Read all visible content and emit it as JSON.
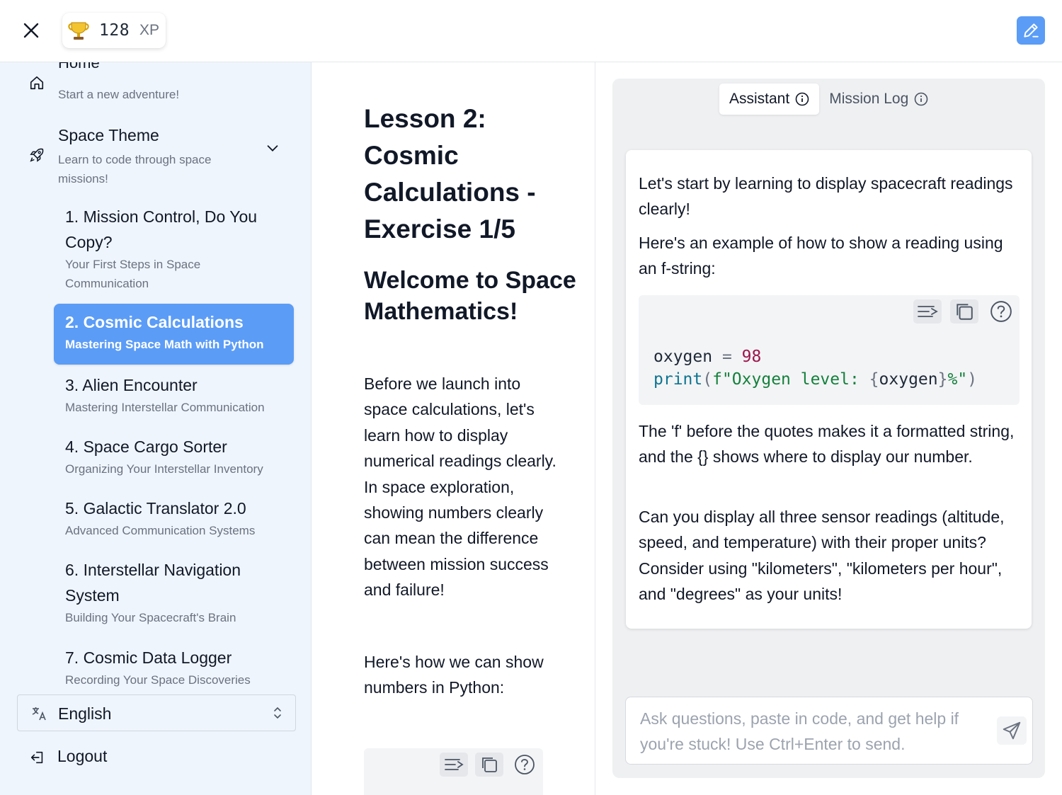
{
  "topbar": {
    "xp_value": "128",
    "xp_unit": "XP"
  },
  "sidebar": {
    "home": {
      "title": "Home",
      "subtitle": "Start a new adventure!"
    },
    "theme": {
      "title": "Space Theme",
      "subtitle": "Learn to code through space missions!"
    },
    "lessons": [
      {
        "title": "1. Mission Control, Do You Copy?",
        "subtitle": "Your First Steps in Space Communication",
        "active": false
      },
      {
        "title": "2. Cosmic Calculations",
        "subtitle": "Mastering Space Math with Python",
        "active": true
      },
      {
        "title": "3. Alien Encounter",
        "subtitle": "Mastering Interstellar Communication",
        "active": false
      },
      {
        "title": "4. Space Cargo Sorter",
        "subtitle": "Organizing Your Interstellar Inventory",
        "active": false
      },
      {
        "title": "5. Galactic Translator 2.0",
        "subtitle": "Advanced Communication Systems",
        "active": false
      },
      {
        "title": "6. Interstellar Navigation System",
        "subtitle": "Building Your Spacecraft's Brain",
        "active": false
      },
      {
        "title": "7. Cosmic Data Logger",
        "subtitle": "Recording Your Space Discoveries",
        "active": false
      }
    ],
    "language": "English",
    "logout": "Logout"
  },
  "content": {
    "title": "Lesson 2: Cosmic Calculations - Exercise 1/5",
    "heading": "Welcome to Space Mathematics!",
    "para1": "Before we launch into space calculations, let's learn how to display numerical readings clearly. In space exploration, showing numbers clearly can mean the difference between mission success and failure!",
    "para2": "Here's how we can show numbers in Python:"
  },
  "assistant": {
    "tabs": [
      {
        "label": "Assistant",
        "active": true
      },
      {
        "label": "Mission Log",
        "active": false
      }
    ],
    "message": {
      "p1": "Let's start by learning to display spacecraft readings clearly!",
      "p2": "Here's an example of how to show a reading using an f-string:",
      "code": {
        "line1_var": "oxygen",
        "line1_op": "=",
        "line1_num": "98",
        "line2_fn": "print",
        "line2_open": "(",
        "line2_str_start": "f\"Oxygen level: ",
        "line2_brace_open": "{",
        "line2_var": "oxygen",
        "line2_brace_close": "}",
        "line2_str_end": "%\"",
        "line2_close": ")"
      },
      "p3": "The 'f' before the quotes makes it a formatted string, and the {} shows where to display our number.",
      "p4": "Can you display all three sensor readings (altitude, speed, and temperature) with their proper units? Consider using \"kilometers\", \"kilometers per hour\", and \"degrees\" as your units!"
    },
    "input_placeholder": "Ask questions, paste in code, and get help if you're stuck! Use Ctrl+Enter to send."
  },
  "colors": {
    "accent": "#5b9cf6",
    "sidebar_bg": "#eff5fc",
    "panel_bg": "#eff0f2",
    "code_bg": "#f3f4f6"
  },
  "icons": [
    "close-icon",
    "trophy-icon",
    "edit-icon",
    "home-icon",
    "rocket-icon",
    "chevron-down-icon",
    "translate-icon",
    "updown-icon",
    "logout-icon",
    "wrap-icon",
    "copy-icon",
    "help-icon",
    "info-icon",
    "send-icon"
  ]
}
